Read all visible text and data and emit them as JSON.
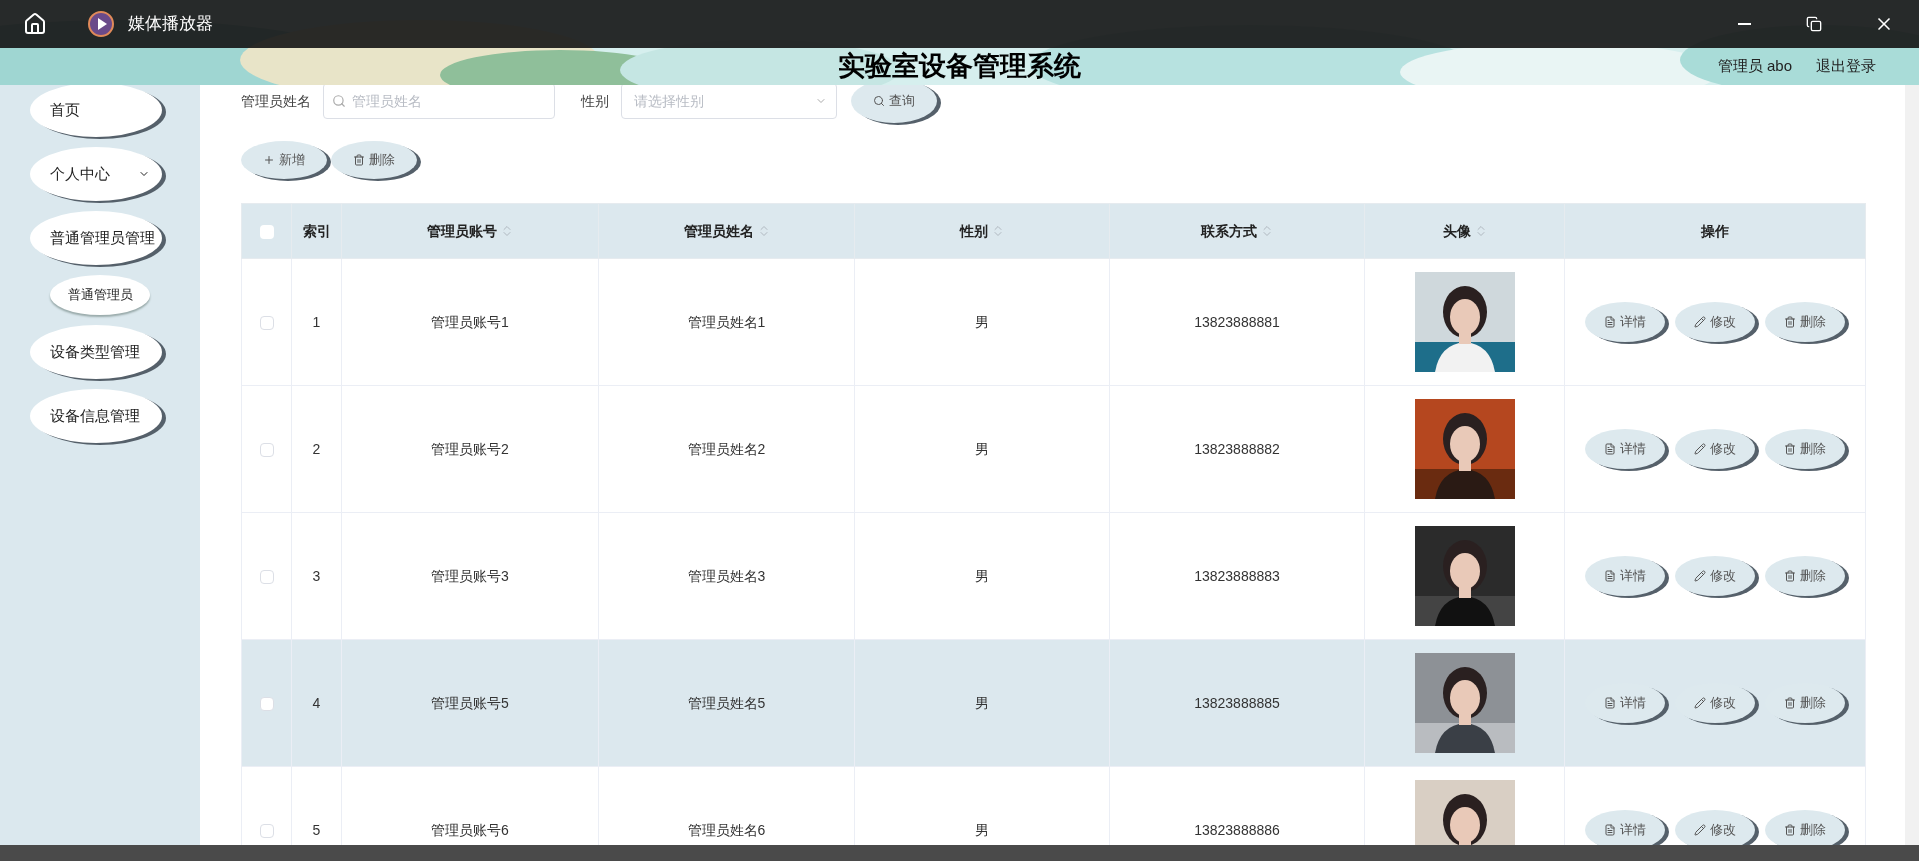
{
  "window": {
    "title": "媒体播放器"
  },
  "header": {
    "title": "实验室设备管理系统",
    "user": "管理员 abo",
    "logout": "退出登录"
  },
  "sidebar": {
    "items": [
      {
        "label": "首页",
        "kind": "link"
      },
      {
        "label": "个人中心",
        "kind": "group",
        "expanded": false
      },
      {
        "label": "普通管理员管理",
        "kind": "group_open",
        "children": [
          {
            "label": "普通管理员"
          }
        ]
      },
      {
        "label": "设备类型管理",
        "kind": "link"
      },
      {
        "label": "设备信息管理",
        "kind": "link"
      }
    ]
  },
  "search": {
    "fields": [
      {
        "label": "管理员姓名",
        "placeholder": "管理员姓名",
        "kind": "text"
      },
      {
        "label": "性别",
        "placeholder": "请选择性别",
        "kind": "select"
      }
    ],
    "button": "查询"
  },
  "toolbar": [
    {
      "label": "新增",
      "kind": "add"
    },
    {
      "label": "删除",
      "kind": "delete"
    }
  ],
  "table": {
    "columns": [
      {
        "label": "索引",
        "sortable": false
      },
      {
        "label": "管理员账号",
        "sortable": true
      },
      {
        "label": "管理员姓名",
        "sortable": true
      },
      {
        "label": "性别",
        "sortable": true
      },
      {
        "label": "联系方式",
        "sortable": true
      },
      {
        "label": "头像",
        "sortable": true
      },
      {
        "label": "操作",
        "sortable": false
      }
    ],
    "all_checked": false,
    "rows": [
      {
        "index": "1",
        "account": "管理员账号1",
        "name": "管理员姓名1",
        "gender": "男",
        "phone": "13823888881",
        "checked": false,
        "highlighted": false,
        "actions": [
          {
            "label": "详情",
            "kind": "detail"
          },
          {
            "label": "修改",
            "kind": "edit"
          },
          {
            "label": "删除",
            "kind": "delete"
          }
        ]
      },
      {
        "index": "2",
        "account": "管理员账号2",
        "name": "管理员姓名2",
        "gender": "男",
        "phone": "13823888882",
        "checked": false,
        "highlighted": false,
        "actions": [
          {
            "label": "详情",
            "kind": "detail"
          },
          {
            "label": "修改",
            "kind": "edit"
          },
          {
            "label": "删除",
            "kind": "delete"
          }
        ]
      },
      {
        "index": "3",
        "account": "管理员账号3",
        "name": "管理员姓名3",
        "gender": "男",
        "phone": "13823888883",
        "checked": false,
        "highlighted": false,
        "actions": [
          {
            "label": "详情",
            "kind": "detail"
          },
          {
            "label": "修改",
            "kind": "edit"
          },
          {
            "label": "删除",
            "kind": "delete"
          }
        ]
      },
      {
        "index": "4",
        "account": "管理员账号5",
        "name": "管理员姓名5",
        "gender": "男",
        "phone": "13823888885",
        "checked": false,
        "highlighted": true,
        "actions": [
          {
            "label": "详情",
            "kind": "detail"
          },
          {
            "label": "修改",
            "kind": "edit"
          },
          {
            "label": "删除",
            "kind": "delete"
          }
        ]
      },
      {
        "index": "5",
        "account": "管理员账号6",
        "name": "管理员姓名6",
        "gender": "男",
        "phone": "13823888886",
        "checked": false,
        "highlighted": false,
        "actions": [
          {
            "label": "详情",
            "kind": "detail"
          },
          {
            "label": "修改",
            "kind": "edit"
          },
          {
            "label": "删除",
            "kind": "delete"
          }
        ]
      }
    ]
  }
}
